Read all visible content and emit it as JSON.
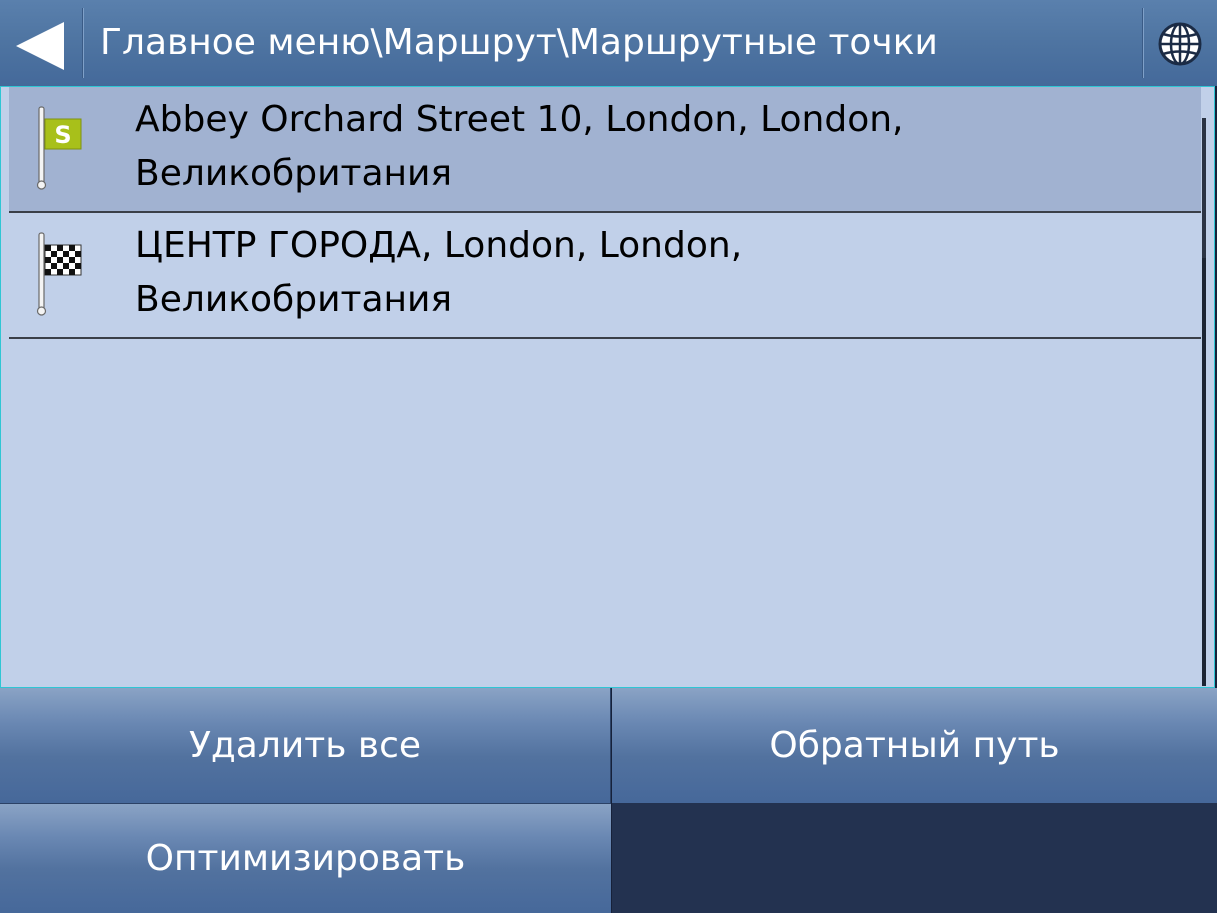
{
  "header": {
    "breadcrumb": "Главное меню\\Маршрут\\Маршрутные точки",
    "back_icon": "back-arrow-icon",
    "globe_icon": "globe-icon"
  },
  "waypoints": [
    {
      "icon": "start-flag-icon",
      "flag_letter": "S",
      "line1": "Abbey Orchard Street 10, London, London,",
      "line2": "Великобритания",
      "selected": true
    },
    {
      "icon": "finish-flag-icon",
      "line1": "ЦЕНТР ГОРОДА, London, London,",
      "line2": "Великобритания",
      "selected": false
    }
  ],
  "buttons": {
    "delete_all": "Удалить все",
    "reverse": "Обратный путь",
    "optimize": "Оптимизировать"
  },
  "colors": {
    "header_bg": "#4f75a2",
    "list_bg": "#c1d0e9",
    "selected_row_bg": "#a1b2d1",
    "list_border": "#2fc6d4",
    "start_flag": "#a8c01a"
  }
}
